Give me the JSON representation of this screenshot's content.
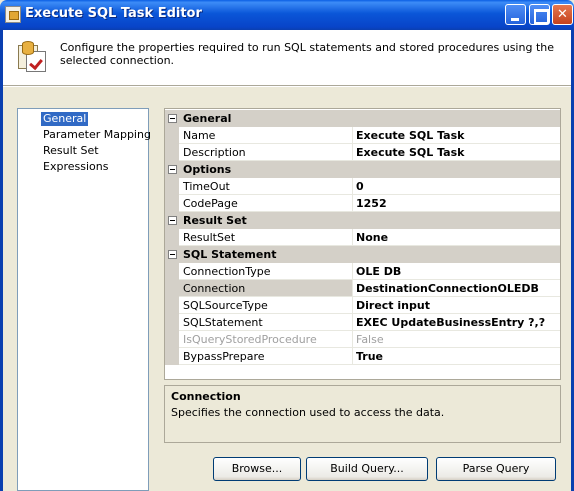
{
  "window": {
    "title": "Execute SQL Task Editor",
    "buttons": [
      "minimize",
      "maximize",
      "close"
    ],
    "icon": "ssis-task-icon"
  },
  "header": {
    "description": "Configure the properties required to run SQL statements and stored procedures using the selected connection.",
    "icon": "sql-task-icon"
  },
  "nav": {
    "items": [
      {
        "label": "General",
        "selected": true
      },
      {
        "label": "Parameter Mapping",
        "selected": false
      },
      {
        "label": "Result Set",
        "selected": false
      },
      {
        "label": "Expressions",
        "selected": false
      }
    ]
  },
  "grid": {
    "categories": [
      {
        "label": "General",
        "rows": [
          {
            "name": "Name",
            "value": "Execute SQL Task"
          },
          {
            "name": "Description",
            "value": "Execute SQL Task"
          }
        ]
      },
      {
        "label": "Options",
        "rows": [
          {
            "name": "TimeOut",
            "value": "0"
          },
          {
            "name": "CodePage",
            "value": "1252"
          }
        ]
      },
      {
        "label": "Result Set",
        "rows": [
          {
            "name": "ResultSet",
            "value": "None"
          }
        ]
      },
      {
        "label": "SQL Statement",
        "rows": [
          {
            "name": "ConnectionType",
            "value": "OLE DB"
          },
          {
            "name": "Connection",
            "value": "DestinationConnectionOLEDB",
            "selected": true
          },
          {
            "name": "SQLSourceType",
            "value": "Direct input"
          },
          {
            "name": "SQLStatement",
            "value": "EXEC UpdateBusinessEntry ?,?"
          },
          {
            "name": "IsQueryStoredProcedure",
            "value": "False",
            "disabled": true
          },
          {
            "name": "BypassPrepare",
            "value": "True"
          }
        ]
      }
    ]
  },
  "help": {
    "title": "Connection",
    "text": "Specifies the connection used to access the data."
  },
  "buttons": {
    "browse": "Browse...",
    "build_query": "Build Query...",
    "parse_query": "Parse Query"
  },
  "colors": {
    "titlebar": "#0a56d8",
    "selection": "#316ac5",
    "category_bg": "#d4d0c8",
    "dialog_bg": "#ece9d8"
  }
}
